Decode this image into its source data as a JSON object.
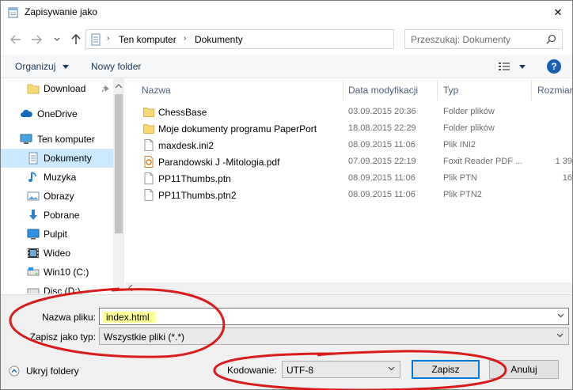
{
  "window": {
    "title": "Zapisywanie jako",
    "close_glyph": "✕"
  },
  "address": {
    "crumbs": [
      "Ten komputer",
      "Dokumenty"
    ],
    "search_placeholder": "Przeszukaj: Dokumenty"
  },
  "toolbar": {
    "organize_label": "Organizuj",
    "new_folder_label": "Nowy folder",
    "help_label": "?"
  },
  "navigation": {
    "items": [
      {
        "label": "Download",
        "icon": "folder-icon",
        "pinned": true
      },
      {
        "label": "OneDrive",
        "icon": "cloud-icon"
      },
      {
        "label": "Ten komputer",
        "icon": "computer-icon"
      },
      {
        "label": "Dokumenty",
        "icon": "documents-icon",
        "selected": true
      },
      {
        "label": "Muzyka",
        "icon": "music-icon"
      },
      {
        "label": "Obrazy",
        "icon": "pictures-icon"
      },
      {
        "label": "Pobrane",
        "icon": "download-arrow-icon"
      },
      {
        "label": "Pulpit",
        "icon": "desktop-icon"
      },
      {
        "label": "Wideo",
        "icon": "video-icon"
      },
      {
        "label": "Win10 (C:)",
        "icon": "drive-icon"
      },
      {
        "label": "Disc (D:)",
        "icon": "drive-icon"
      }
    ]
  },
  "filelist": {
    "columns": [
      "Nazwa",
      "Data modyfikacji",
      "Typ",
      "Rozmiar"
    ],
    "rows": [
      {
        "name": "ChessBase",
        "date": "03.09.2015 20:36",
        "type": "Folder plików",
        "size": "",
        "icon": "folder-icon"
      },
      {
        "name": "Moje dokumenty programu PaperPort",
        "date": "18.08.2015 22:29",
        "type": "Folder plików",
        "size": "",
        "icon": "folder-icon"
      },
      {
        "name": "maxdesk.ini2",
        "date": "08.09.2015 11:06",
        "type": "Plik INI2",
        "size": "",
        "icon": "file-icon"
      },
      {
        "name": "Parandowski J -Mitologia.pdf",
        "date": "07.09.2015 22:19",
        "type": "Foxit Reader PDF ...",
        "size": "1 39",
        "icon": "pdf-icon"
      },
      {
        "name": "PP11Thumbs.ptn",
        "date": "08.09.2015 11:06",
        "type": "Plik PTN",
        "size": "16",
        "icon": "file-icon"
      },
      {
        "name": "PP11Thumbs.ptn2",
        "date": "08.09.2015 11:06",
        "type": "Plik PTN2",
        "size": "",
        "icon": "file-icon"
      }
    ]
  },
  "save": {
    "filename_label": "Nazwa pliku:",
    "filename_value": "index.html",
    "filetype_label": "Zapisz jako typ:",
    "filetype_value": "Wszystkie pliki  (*.*)",
    "encoding_label": "Kodowanie:",
    "encoding_value": "UTF-8",
    "save_label": "Zapisz",
    "cancel_label": "Anuluj",
    "hide_folders_label": "Ukryj foldery"
  },
  "colors": {
    "annotation_red": "#d81b1b",
    "selection_blue": "#cce8ff",
    "folder_yellow": "#f8d775"
  }
}
